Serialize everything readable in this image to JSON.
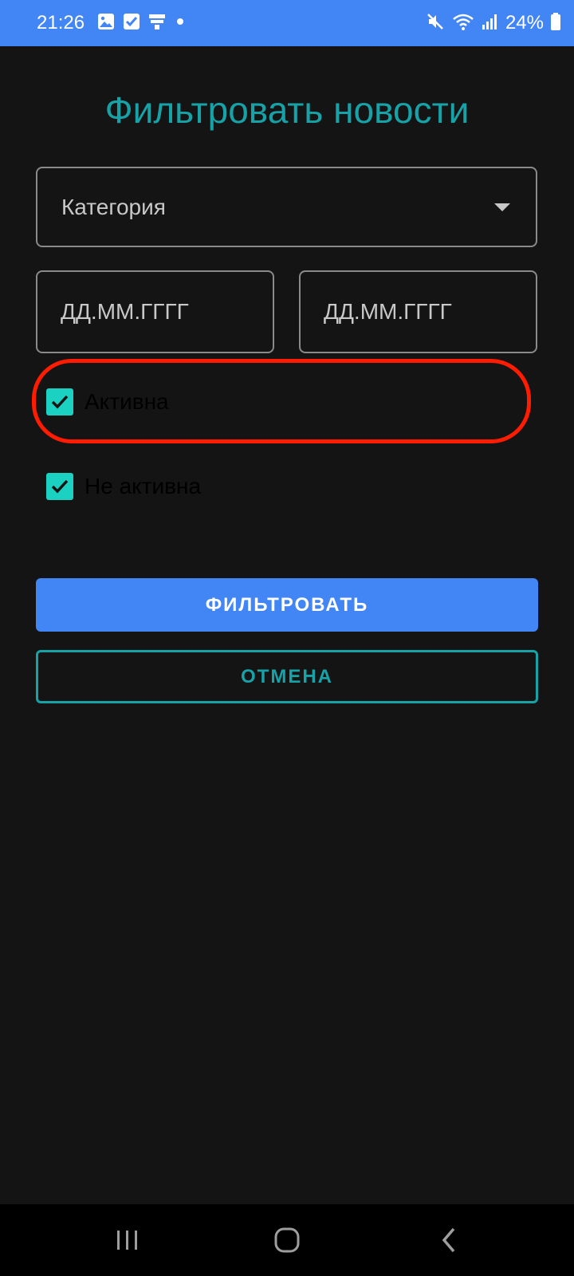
{
  "status_bar": {
    "time": "21:26",
    "battery_text": "24%",
    "background_color": "#4285f4",
    "left_icons": [
      "gallery-icon",
      "checkbox-notification-icon",
      "news-notification-icon",
      "dot-icon"
    ],
    "right_icons": [
      "mute-icon",
      "wifi-icon",
      "signal-icon",
      "battery-icon"
    ]
  },
  "page": {
    "title": "Фильтровать новости",
    "accent_color": "#17a2a8"
  },
  "filters": {
    "category": {
      "placeholder": "Категория",
      "icon": "dropdown-arrow-icon"
    },
    "date_from": {
      "placeholder": "ДД.ММ.ГГГГ"
    },
    "date_to": {
      "placeholder": "ДД.ММ.ГГГГ"
    },
    "checkboxes": [
      {
        "label": "Активна",
        "checked": true
      },
      {
        "label": "Не активна",
        "checked": true
      }
    ],
    "checkbox_color": "#1ad1c2"
  },
  "actions": {
    "filter_label": "ФИЛЬТРОВАТЬ",
    "cancel_label": "ОТМЕНА",
    "primary_color": "#4285f4"
  },
  "annotation": {
    "highlight_color": "#ff1c00"
  },
  "nav_bar": {
    "buttons": [
      "recents-icon",
      "home-icon",
      "back-icon"
    ]
  }
}
